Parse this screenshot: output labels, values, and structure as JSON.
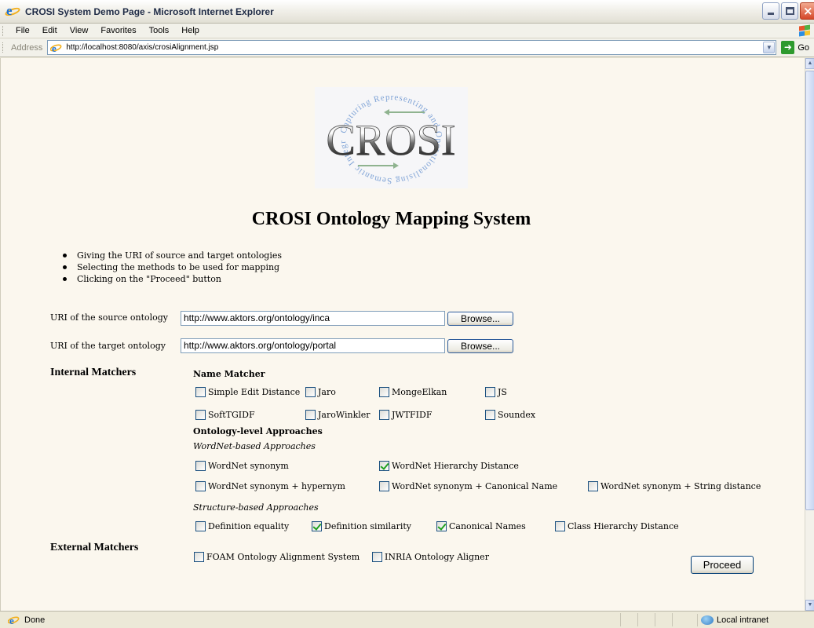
{
  "window": {
    "title": "CROSI System Demo Page - Microsoft Internet Explorer",
    "icon": "ie-icon"
  },
  "menu": [
    "File",
    "Edit",
    "View",
    "Favorites",
    "Tools",
    "Help"
  ],
  "address": {
    "label": "Address",
    "url": "http://localhost:8080/axis/crosiAlignment.jsp",
    "go_label": "Go"
  },
  "page": {
    "logo_text": "CROSI",
    "logo_ring_text": "Capturing Representing and Operationalising Semantic Integration",
    "heading": "CROSI Ontology Mapping System",
    "steps": [
      "Giving the URI of source and target ontologies",
      "Selecting the methods to be used for mapping",
      "Clicking on the \"Proceed\" button"
    ],
    "source": {
      "label": "URI of the source ontology",
      "value": "http://www.aktors.org/ontology/inca",
      "browse": "Browse..."
    },
    "target": {
      "label": "URI of the target ontology",
      "value": "http://www.aktors.org/ontology/portal",
      "browse": "Browse..."
    },
    "internal_title": "Internal Matchers",
    "name_matcher_title": "Name Matcher",
    "name_matchers": [
      {
        "label": "Simple Edit Distance",
        "checked": false
      },
      {
        "label": "Jaro",
        "checked": false
      },
      {
        "label": "MongeElkan",
        "checked": false
      },
      {
        "label": "JS",
        "checked": false
      },
      {
        "label": "SoftTGIDF",
        "checked": false
      },
      {
        "label": "JaroWinkler",
        "checked": false
      },
      {
        "label": "JWTFIDF",
        "checked": false
      },
      {
        "label": "Soundex",
        "checked": false
      }
    ],
    "ontology_title": "Ontology-level Approaches",
    "wordnet_title": "WordNet-based Approaches",
    "wordnet": [
      {
        "label": "WordNet synonym",
        "checked": false
      },
      {
        "label": "WordNet Hierarchy Distance",
        "checked": true
      },
      {
        "label": "WordNet synonym + hypernym",
        "checked": false
      },
      {
        "label": "WordNet synonym + Canonical Name",
        "checked": false
      },
      {
        "label": "WordNet synonym + String distance",
        "checked": false
      }
    ],
    "structure_title": "Structure-based Approaches",
    "structure": [
      {
        "label": "Definition equality",
        "checked": false
      },
      {
        "label": "Definition similarity",
        "checked": true
      },
      {
        "label": "Canonical Names",
        "checked": true
      },
      {
        "label": "Class Hierarchy Distance",
        "checked": false
      }
    ],
    "external_title": "External Matchers",
    "external": [
      {
        "label": "FOAM Ontology Alignment System",
        "checked": false
      },
      {
        "label": "INRIA Ontology Aligner",
        "checked": false
      }
    ],
    "proceed": "Proceed"
  },
  "status": {
    "text": "Done",
    "zone": "Local intranet"
  }
}
